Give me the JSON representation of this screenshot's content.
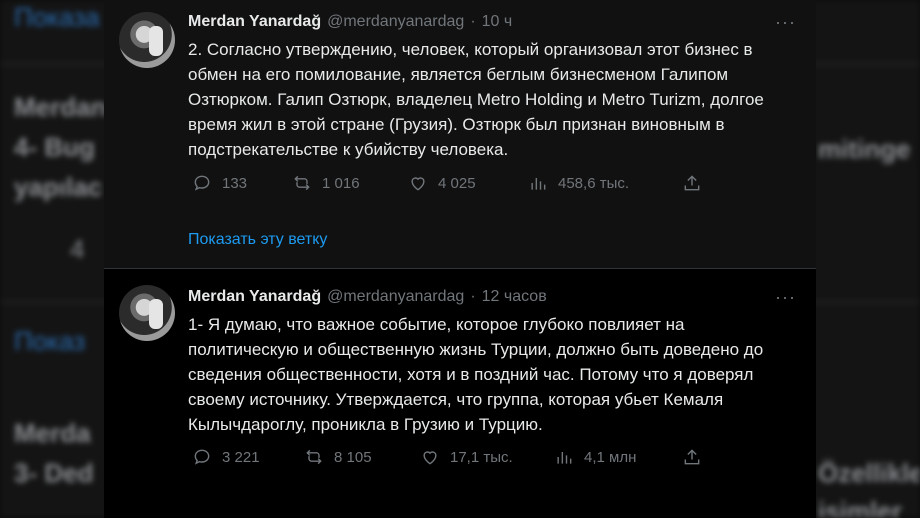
{
  "background": {
    "texts": [
      "Показа",
      "Merdan",
      "4- Bug",
      "yapılac",
      "4",
      "mitinge",
      "Показ",
      "Merda",
      "3- Ded",
      "Özellikle",
      "isimler"
    ]
  },
  "tweets": [
    {
      "author_name": "Merdan Yanardağ",
      "handle": "@merdanyanardag",
      "separator": "·",
      "time": "10 ч",
      "body": "2. Согласно утверждению, человек, который организовал этот бизнес в обмен на его помилование, является беглым бизнесменом Галипом Озтюрком. Галип Озтюрк, владелец Metro Holding и Metro Turizm, долгое время жил в этой стране (Грузия). Озтюрк был признан виновным в подстрекательстве к убийству человека.",
      "replies": "133",
      "retweets": "1 016",
      "likes": "4 025",
      "views": "458,6 тыс.",
      "show_thread": "Показать эту ветку"
    },
    {
      "author_name": "Merdan Yanardağ",
      "handle": "@merdanyanardag",
      "separator": "·",
      "time": "12 часов",
      "body": "1- Я думаю, что важное событие, которое глубоко повлияет на политическую и общественную жизнь Турции, должно быть доведено до сведения общественности, хотя и в поздний час. Потому что я доверял своему источнику. Утверждается, что группа, которая убьет Кемаля Кылычдароглу, проникла в Грузию и Турцию.",
      "replies": "3 221",
      "retweets": "8 105",
      "likes": "17,1 тыс.",
      "views": "4,1 млн"
    }
  ],
  "icons": {
    "reply": "reply-icon",
    "retweet": "retweet-icon",
    "like": "heart-icon",
    "views": "views-chart-icon",
    "share": "share-icon",
    "more": "more-icon"
  },
  "colors": {
    "link": "#1d9bf0",
    "muted": "#71767b",
    "text": "#e7e9ea"
  }
}
